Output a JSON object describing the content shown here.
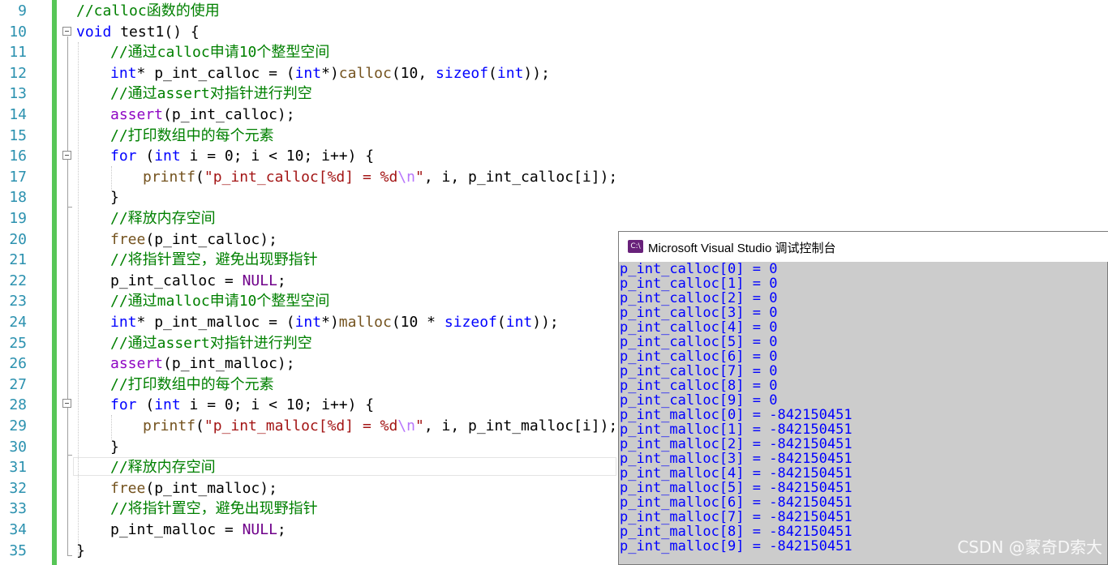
{
  "editor": {
    "line_numbers": [
      "9",
      "10",
      "11",
      "12",
      "13",
      "14",
      "15",
      "16",
      "17",
      "18",
      "19",
      "20",
      "21",
      "22",
      "23",
      "24",
      "25",
      "26",
      "27",
      "28",
      "29",
      "30",
      "31",
      "32",
      "33",
      "34",
      "35"
    ],
    "lines": [
      {
        "indent": 0,
        "tokens": [
          {
            "c": "cm",
            "t": "//calloc函数的使用"
          }
        ]
      },
      {
        "indent": 0,
        "tokens": [
          {
            "c": "kw",
            "t": "void"
          },
          {
            "c": "",
            "t": " test1() {"
          }
        ]
      },
      {
        "indent": 1,
        "tokens": [
          {
            "c": "cm",
            "t": "//通过calloc申请10个整型空间"
          }
        ]
      },
      {
        "indent": 1,
        "tokens": [
          {
            "c": "kw",
            "t": "int"
          },
          {
            "c": "",
            "t": "* p_int_calloc = ("
          },
          {
            "c": "kw",
            "t": "int"
          },
          {
            "c": "",
            "t": "*)"
          },
          {
            "c": "fn",
            "t": "calloc"
          },
          {
            "c": "",
            "t": "(10, "
          },
          {
            "c": "kw",
            "t": "sizeof"
          },
          {
            "c": "",
            "t": "("
          },
          {
            "c": "kw",
            "t": "int"
          },
          {
            "c": "",
            "t": "));"
          }
        ]
      },
      {
        "indent": 1,
        "tokens": [
          {
            "c": "cm",
            "t": "//通过assert对指针进行判空"
          }
        ]
      },
      {
        "indent": 1,
        "tokens": [
          {
            "c": "mac",
            "t": "assert"
          },
          {
            "c": "",
            "t": "(p_int_calloc);"
          }
        ]
      },
      {
        "indent": 1,
        "tokens": [
          {
            "c": "cm",
            "t": "//打印数组中的每个元素"
          }
        ]
      },
      {
        "indent": 1,
        "tokens": [
          {
            "c": "kw",
            "t": "for"
          },
          {
            "c": "",
            "t": " ("
          },
          {
            "c": "kw",
            "t": "int"
          },
          {
            "c": "",
            "t": " i = 0; i < 10; i++) {"
          }
        ]
      },
      {
        "indent": 2,
        "tokens": [
          {
            "c": "fn",
            "t": "printf"
          },
          {
            "c": "",
            "t": "("
          },
          {
            "c": "str",
            "t": "\"p_int_calloc[%d] = %d"
          },
          {
            "c": "esc",
            "t": "\\n"
          },
          {
            "c": "str",
            "t": "\""
          },
          {
            "c": "",
            "t": ", i, p_int_calloc[i]);"
          }
        ]
      },
      {
        "indent": 1,
        "tokens": [
          {
            "c": "",
            "t": "}"
          }
        ]
      },
      {
        "indent": 1,
        "tokens": [
          {
            "c": "cm",
            "t": "//释放内存空间"
          }
        ]
      },
      {
        "indent": 1,
        "tokens": [
          {
            "c": "fn",
            "t": "free"
          },
          {
            "c": "",
            "t": "(p_int_calloc);"
          }
        ]
      },
      {
        "indent": 1,
        "tokens": [
          {
            "c": "cm",
            "t": "//将指针置空，避免出现野指针"
          }
        ]
      },
      {
        "indent": 1,
        "tokens": [
          {
            "c": "",
            "t": "p_int_calloc = "
          },
          {
            "c": "nul",
            "t": "NULL"
          },
          {
            "c": "",
            "t": ";"
          }
        ]
      },
      {
        "indent": 1,
        "tokens": [
          {
            "c": "cm",
            "t": "//通过malloc申请10个整型空间"
          }
        ]
      },
      {
        "indent": 1,
        "tokens": [
          {
            "c": "kw",
            "t": "int"
          },
          {
            "c": "",
            "t": "* p_int_malloc = ("
          },
          {
            "c": "kw",
            "t": "int"
          },
          {
            "c": "",
            "t": "*)"
          },
          {
            "c": "fn",
            "t": "malloc"
          },
          {
            "c": "",
            "t": "(10 * "
          },
          {
            "c": "kw",
            "t": "sizeof"
          },
          {
            "c": "",
            "t": "("
          },
          {
            "c": "kw",
            "t": "int"
          },
          {
            "c": "",
            "t": "));"
          }
        ]
      },
      {
        "indent": 1,
        "tokens": [
          {
            "c": "cm",
            "t": "//通过assert对指针进行判空"
          }
        ]
      },
      {
        "indent": 1,
        "tokens": [
          {
            "c": "mac",
            "t": "assert"
          },
          {
            "c": "",
            "t": "(p_int_malloc);"
          }
        ]
      },
      {
        "indent": 1,
        "tokens": [
          {
            "c": "cm",
            "t": "//打印数组中的每个元素"
          }
        ]
      },
      {
        "indent": 1,
        "tokens": [
          {
            "c": "kw",
            "t": "for"
          },
          {
            "c": "",
            "t": " ("
          },
          {
            "c": "kw",
            "t": "int"
          },
          {
            "c": "",
            "t": " i = 0; i < 10; i++) {"
          }
        ]
      },
      {
        "indent": 2,
        "tokens": [
          {
            "c": "fn",
            "t": "printf"
          },
          {
            "c": "",
            "t": "("
          },
          {
            "c": "str",
            "t": "\"p_int_malloc[%d] = %d"
          },
          {
            "c": "esc",
            "t": "\\n"
          },
          {
            "c": "str",
            "t": "\""
          },
          {
            "c": "",
            "t": ", i, p_int_malloc[i]);"
          }
        ]
      },
      {
        "indent": 1,
        "tokens": [
          {
            "c": "",
            "t": "}"
          }
        ]
      },
      {
        "indent": 1,
        "tokens": [
          {
            "c": "cm",
            "t": "//释放内存空间"
          }
        ]
      },
      {
        "indent": 1,
        "tokens": [
          {
            "c": "fn",
            "t": "free"
          },
          {
            "c": "",
            "t": "(p_int_malloc);"
          }
        ]
      },
      {
        "indent": 1,
        "tokens": [
          {
            "c": "cm",
            "t": "//将指针置空，避免出现野指针"
          }
        ]
      },
      {
        "indent": 1,
        "tokens": [
          {
            "c": "",
            "t": "p_int_malloc = "
          },
          {
            "c": "nul",
            "t": "NULL"
          },
          {
            "c": "",
            "t": ";"
          }
        ]
      },
      {
        "indent": 0,
        "tokens": [
          {
            "c": "",
            "t": "}"
          }
        ]
      }
    ]
  },
  "console": {
    "title": "Microsoft Visual Studio 调试控制台",
    "icon": "console-app-icon",
    "icon_text": "C:\\",
    "output": [
      "p_int_calloc[0] = 0",
      "p_int_calloc[1] = 0",
      "p_int_calloc[2] = 0",
      "p_int_calloc[3] = 0",
      "p_int_calloc[4] = 0",
      "p_int_calloc[5] = 0",
      "p_int_calloc[6] = 0",
      "p_int_calloc[7] = 0",
      "p_int_calloc[8] = 0",
      "p_int_calloc[9] = 0",
      "p_int_malloc[0] = -842150451",
      "p_int_malloc[1] = -842150451",
      "p_int_malloc[2] = -842150451",
      "p_int_malloc[3] = -842150451",
      "p_int_malloc[4] = -842150451",
      "p_int_malloc[5] = -842150451",
      "p_int_malloc[6] = -842150451",
      "p_int_malloc[7] = -842150451",
      "p_int_malloc[8] = -842150451",
      "p_int_malloc[9] = -842150451"
    ]
  },
  "watermark": "CSDN @蒙奇D索大",
  "colors": {
    "change_bar": "#57c657",
    "line_number": "#2b91af",
    "keyword": "#0000ff",
    "comment": "#008000",
    "console_bg": "#cccccc",
    "console_text": "#0000ff"
  }
}
